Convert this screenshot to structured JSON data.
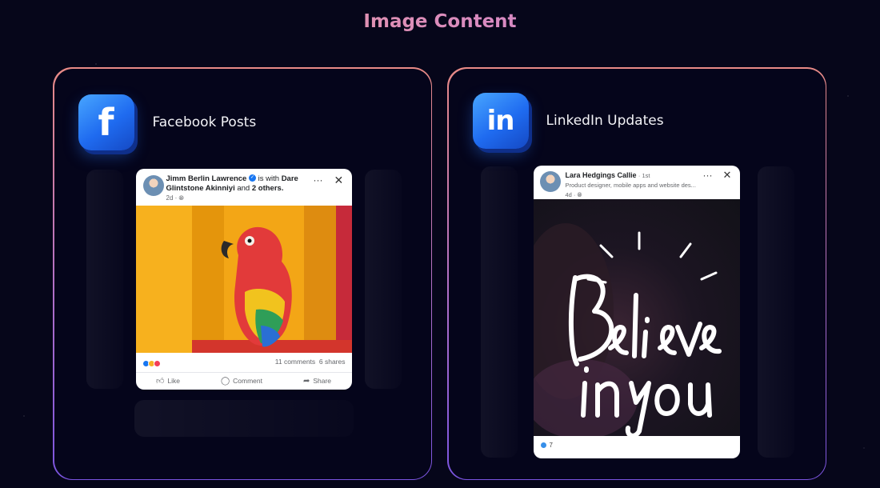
{
  "heading": "Image Content",
  "facebook": {
    "title": "Facebook Posts",
    "icon": "facebook-icon",
    "post": {
      "author": "Jimm Berlin Lawrence",
      "with_text": " is with ",
      "tagged": "Dare Glintstone Akinniyi",
      "and_text": " and ",
      "others": "2 others.",
      "time": "2d · ",
      "comments": "11 comments",
      "shares": "6 shares",
      "actions": {
        "like": "Like",
        "comment": "Comment",
        "share": "Share"
      }
    }
  },
  "linkedin": {
    "title": "LinkedIn Updates",
    "icon": "linkedin-icon",
    "post": {
      "author": "Lara Hedgings Callie",
      "degree": "· 1st",
      "headline": "Product designer, mobile apps and website des...",
      "time": "4d · ",
      "reaction_count": "7"
    }
  },
  "colors": {
    "accent_pink": "#f0a48b",
    "accent_purple": "#b57ee0",
    "brand_blue": "#1f6bf0"
  }
}
